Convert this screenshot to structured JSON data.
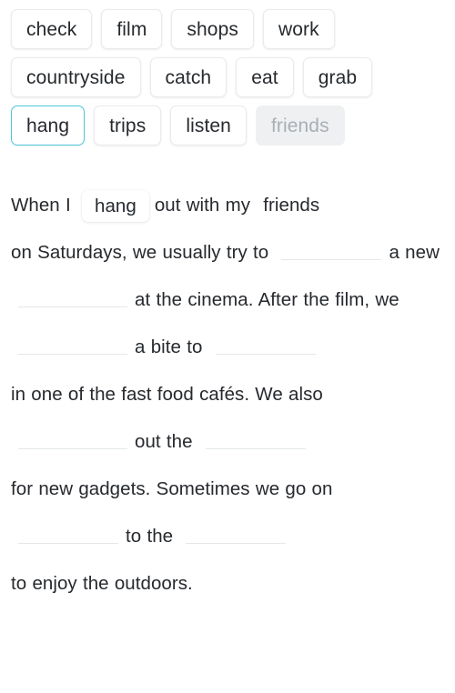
{
  "theme": {
    "background": "#ffffff",
    "text_color": "#26292d",
    "chip_border": "#e9ebed",
    "selected_border": "#4ec6d6",
    "used_chip_bg": "#eef0f2",
    "used_chip_text": "#a9afb5",
    "blank_line": "#e4e7ea"
  },
  "word_bank": {
    "name": "word-bank",
    "chips": [
      {
        "label": "check",
        "state": "available"
      },
      {
        "label": "film",
        "state": "available"
      },
      {
        "label": "shops",
        "state": "available"
      },
      {
        "label": "work",
        "state": "available"
      },
      {
        "label": "countryside",
        "state": "available"
      },
      {
        "label": "catch",
        "state": "available"
      },
      {
        "label": "eat",
        "state": "available"
      },
      {
        "label": "grab",
        "state": "available"
      },
      {
        "label": "hang",
        "state": "selected"
      },
      {
        "label": "trips",
        "state": "available"
      },
      {
        "label": "listen",
        "state": "available"
      },
      {
        "label": "friends",
        "state": "used"
      }
    ]
  },
  "passage": {
    "name": "cloze-passage",
    "tokens": [
      {
        "type": "text",
        "value": "When I"
      },
      {
        "type": "answer",
        "value": "hang"
      },
      {
        "type": "text",
        "value": "out with my"
      },
      {
        "type": "placed",
        "value": "friends"
      },
      {
        "type": "text",
        "value": "on Saturdays, we usually try to"
      },
      {
        "type": "blank",
        "value": "",
        "size": "md"
      },
      {
        "type": "text",
        "value": "a new"
      },
      {
        "type": "blank",
        "value": "",
        "size": "lg"
      },
      {
        "type": "text",
        "value": "at the cinema. After the film, we"
      },
      {
        "type": "blank",
        "value": "",
        "size": "lg"
      },
      {
        "type": "text",
        "value": "a bite to"
      },
      {
        "type": "blank",
        "value": "",
        "size": "md"
      },
      {
        "type": "text",
        "value": "in one of the fast food cafés. We also"
      },
      {
        "type": "blank",
        "value": "",
        "size": "lg"
      },
      {
        "type": "text",
        "value": "out the"
      },
      {
        "type": "blank",
        "value": "",
        "size": "md"
      },
      {
        "type": "text",
        "value": "for new gadgets. Sometimes we go on"
      },
      {
        "type": "blank",
        "value": "",
        "size": "md"
      },
      {
        "type": "text",
        "value": "to the"
      },
      {
        "type": "blank",
        "value": "",
        "size": "md"
      },
      {
        "type": "text",
        "value": "to enjoy the outdoors."
      }
    ]
  }
}
